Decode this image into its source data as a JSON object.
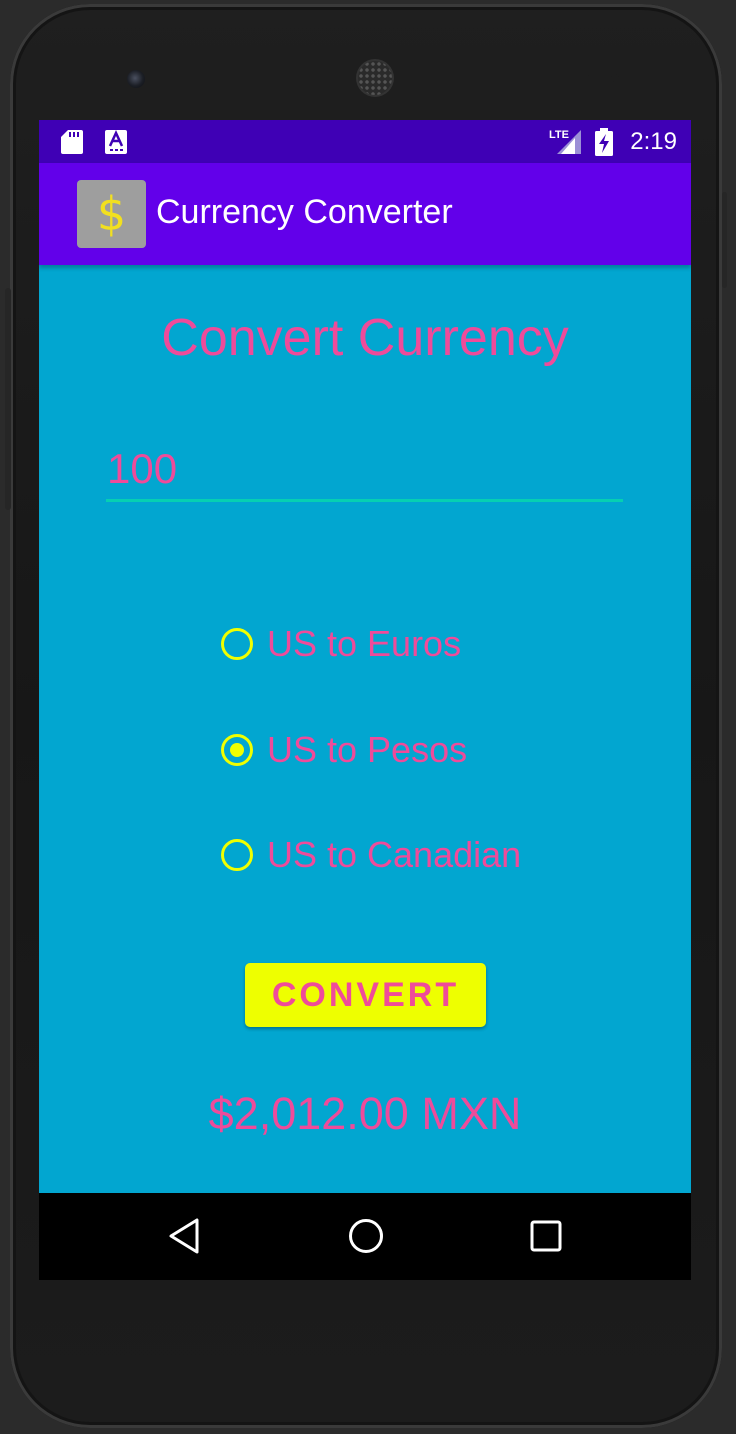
{
  "status_bar": {
    "time": "2:19",
    "network_label": "LTE",
    "icons": [
      "sd-card-icon",
      "keyboard-a-icon",
      "lte-signal-icon",
      "battery-charging-icon"
    ]
  },
  "app_bar": {
    "title": "Currency Converter",
    "icon_glyph": "$"
  },
  "main": {
    "heading": "Convert Currency",
    "amount_value": "100",
    "options": [
      {
        "label": "US to Euros",
        "selected": false
      },
      {
        "label": "US to Pesos",
        "selected": true
      },
      {
        "label": "US to Canadian",
        "selected": false
      }
    ],
    "convert_label": "CONVERT",
    "result": "$2,012.00 MXN"
  },
  "nav_bar": {
    "icons": [
      "back-icon",
      "home-icon",
      "recents-icon"
    ]
  },
  "colors": {
    "status_bar": "#3f00b5",
    "app_bar": "#6200ea",
    "background": "#02a6d0",
    "text_accent": "#ef4b9a",
    "radio_accent": "#f0ff00",
    "button": "#eeff00",
    "input_underline": "#06d0b2"
  }
}
